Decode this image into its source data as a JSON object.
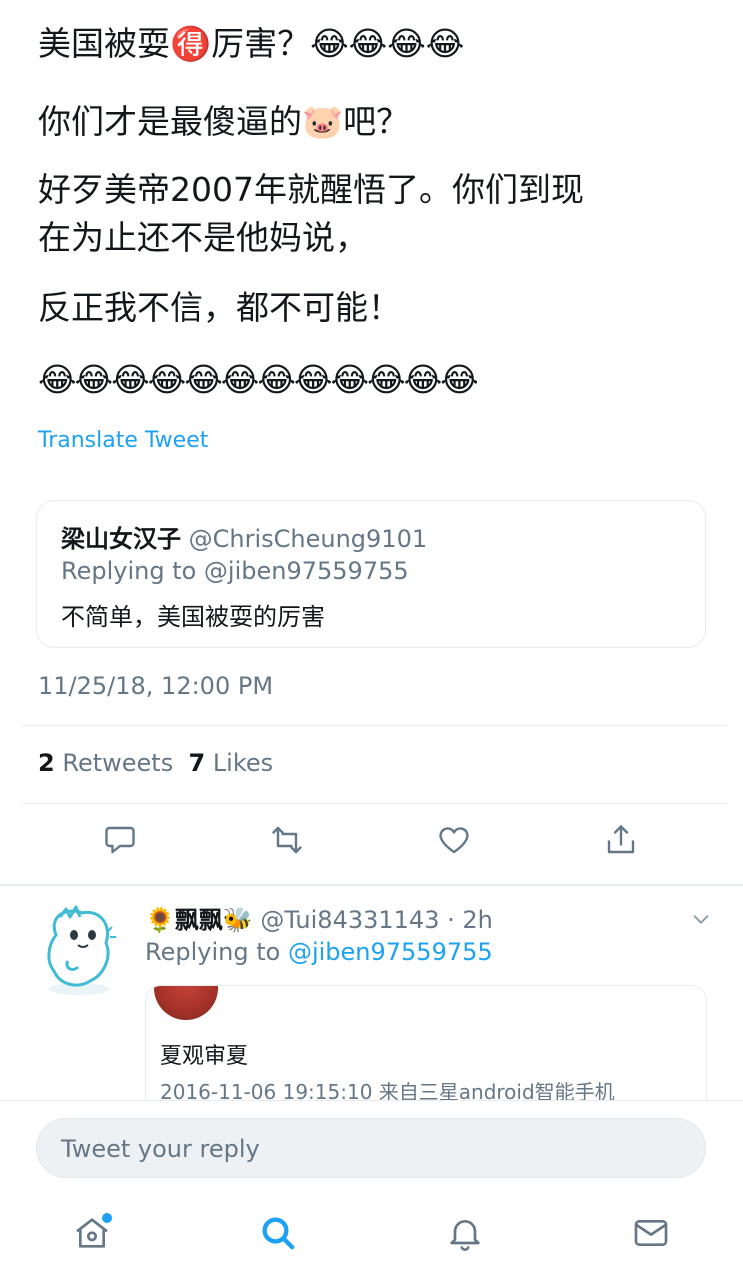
{
  "tweet": {
    "lines": [
      "美国被耍🉐厉害？😂😂😂😂",
      "你们才是最傻逼的🐷吧？",
      "好歹美帝2007年就醒悟了。你们到现",
      "在为止还不是他妈说，",
      "反正我不信，都不可能！"
    ],
    "emoji_row": "😂😂😂😂😂😂😂😂😂😂😂😂",
    "translate_label": "Translate Tweet",
    "timestamp": "11/25/18, 12:00 PM"
  },
  "quoted": {
    "name": "梁山女汉子",
    "handle": "@ChrisCheung9101",
    "replying_to": "Replying to @jiben97559755",
    "text": "不简单，美国被耍的厉害"
  },
  "stats": {
    "retweets_count": "2",
    "retweets_label": "Retweets",
    "likes_count": "7",
    "likes_label": "Likes"
  },
  "reply": {
    "name": "🌻飘飘🐝",
    "handle_time": "@Tui84331143 · 2h",
    "replying_prefix": "Replying to",
    "replying_handle": "@jiben97559755",
    "card_title": "夏观审夏",
    "card_meta": "2016-11-06 19:15:10  来自三星android智能手机"
  },
  "composer": {
    "placeholder": "Tweet your reply"
  },
  "colors": {
    "accent": "#1da1f2",
    "muted": "#657786",
    "text": "#14171a",
    "border": "#e6ecf0"
  },
  "icons": [
    "reply-icon",
    "retweet-icon",
    "like-icon",
    "share-icon",
    "chevron-down-icon",
    "home-icon",
    "search-icon",
    "notifications-icon",
    "messages-icon"
  ]
}
